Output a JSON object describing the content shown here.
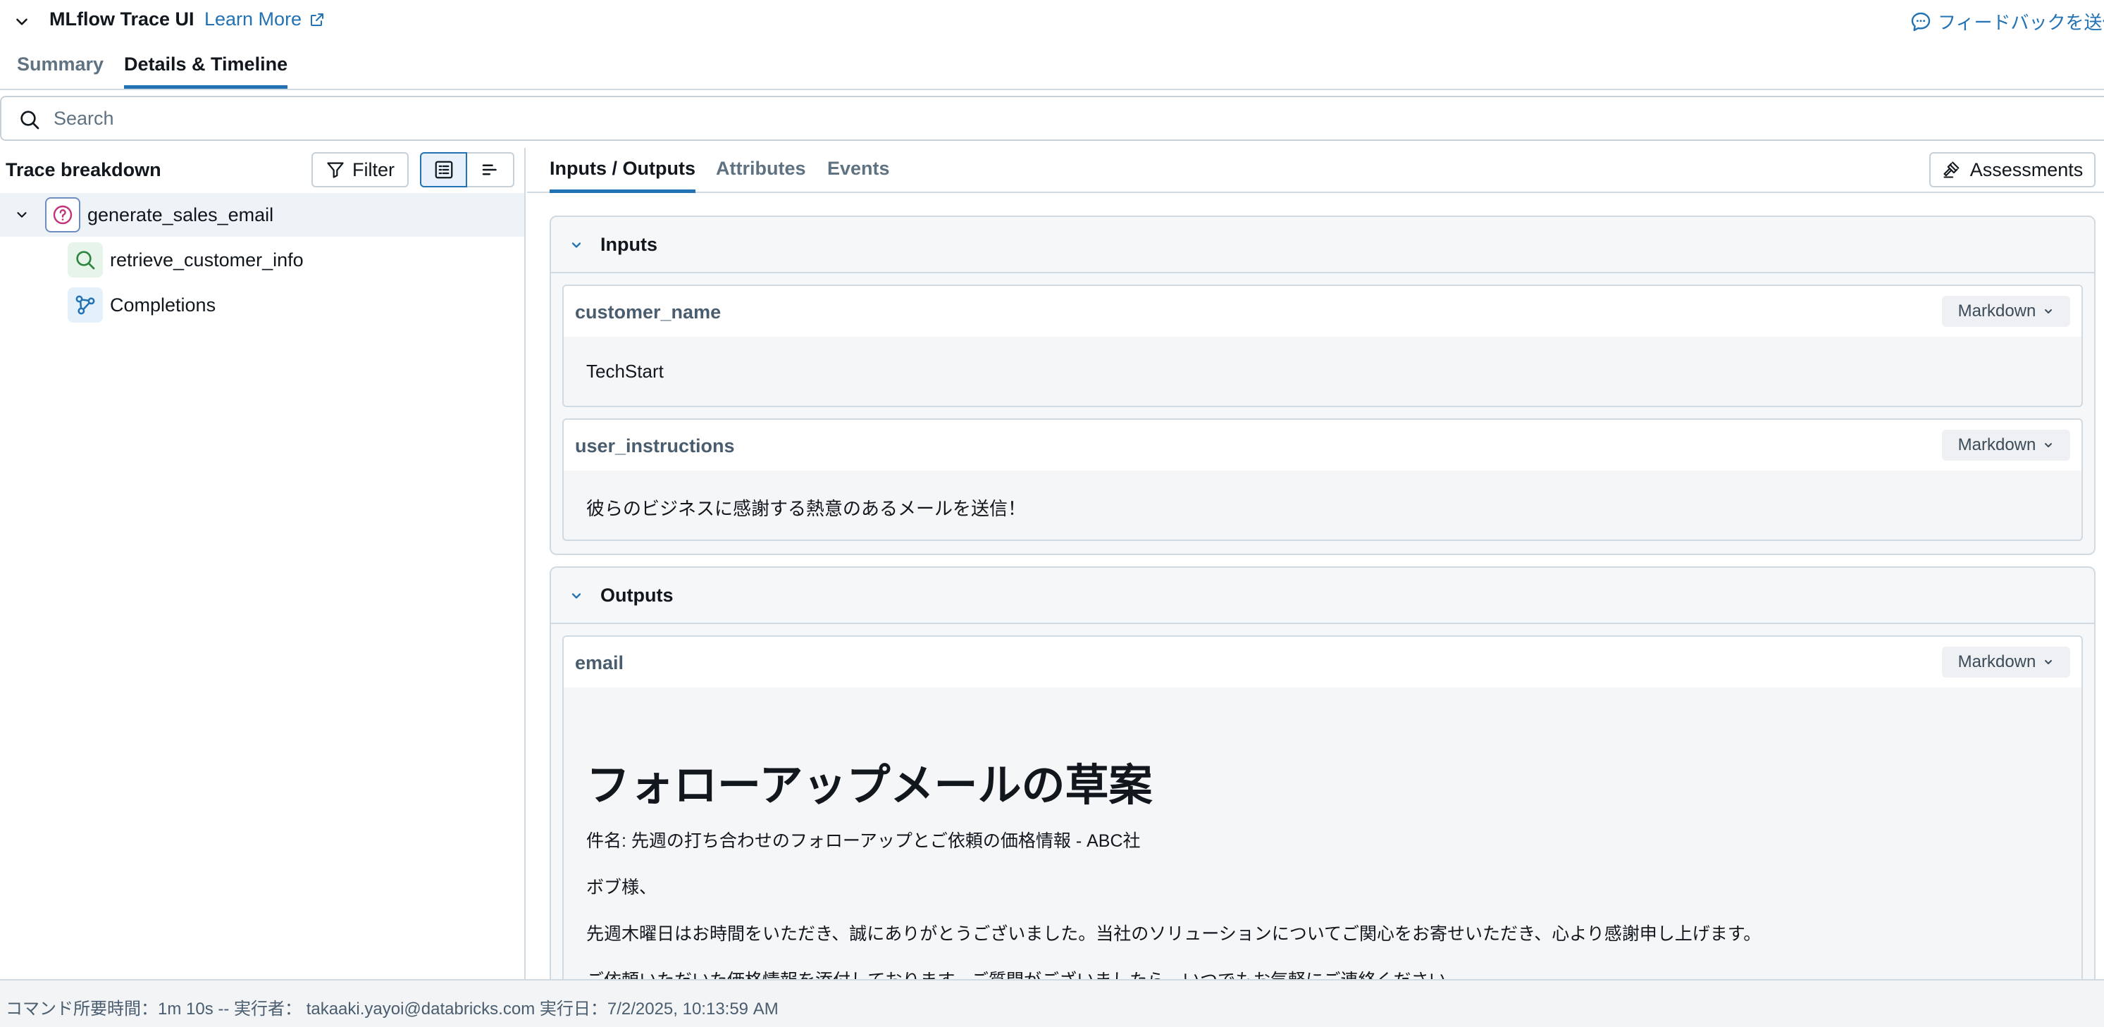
{
  "header": {
    "app_title": "MLflow Trace UI",
    "learn_more": "Learn More",
    "feedback": "フィードバックを送信"
  },
  "top_tabs": [
    {
      "label": "Summary",
      "active": false
    },
    {
      "label": "Details & Timeline",
      "active": true
    }
  ],
  "search": {
    "placeholder": "Search",
    "value": ""
  },
  "trace": {
    "title": "Trace breakdown",
    "filter_label": "Filter",
    "nodes": [
      {
        "label": "generate_sales_email",
        "icon": "question-icon",
        "selected": true
      },
      {
        "label": "retrieve_customer_info",
        "icon": "search-icon"
      },
      {
        "label": "Completions",
        "icon": "nodes-icon"
      }
    ]
  },
  "detail_tabs": [
    {
      "label": "Inputs / Outputs",
      "active": true
    },
    {
      "label": "Attributes",
      "active": false
    },
    {
      "label": "Events",
      "active": false
    }
  ],
  "assessments_label": "Assessments",
  "inputs": {
    "title": "Inputs",
    "fields": [
      {
        "name": "customer_name",
        "format": "Markdown",
        "value": "TechStart"
      },
      {
        "name": "user_instructions",
        "format": "Markdown",
        "value": "彼らのビジネスに感謝する熱意のあるメールを送信！"
      }
    ]
  },
  "outputs": {
    "title": "Outputs",
    "fields": [
      {
        "name": "email",
        "format": "Markdown",
        "heading": "フォローアップメールの草案",
        "lines": [
          "件名: 先週の打ち合わせのフォローアップとご依頼の価格情報 - ABC社",
          "ボブ様、",
          "先週木曜日はお時間をいただき、誠にありがとうございました。当社のソリューションについてご関心をお寄せいただき、心より感謝申し上げます。",
          "ご依頼いただいた価格情報を添付しております。ご質問がございましたら、いつでもお気軽にご連絡ください。"
        ]
      }
    ]
  },
  "footer": {
    "text": "コマンド所要時間：1m 10s -- 実行者： takaaki.yayoi@databricks.com 実行日：7/2/2025, 10:13:59 AM"
  },
  "colors": {
    "accent": "#2272b4",
    "border": "#d1d9e1",
    "selected_row": "#eef3f8"
  }
}
